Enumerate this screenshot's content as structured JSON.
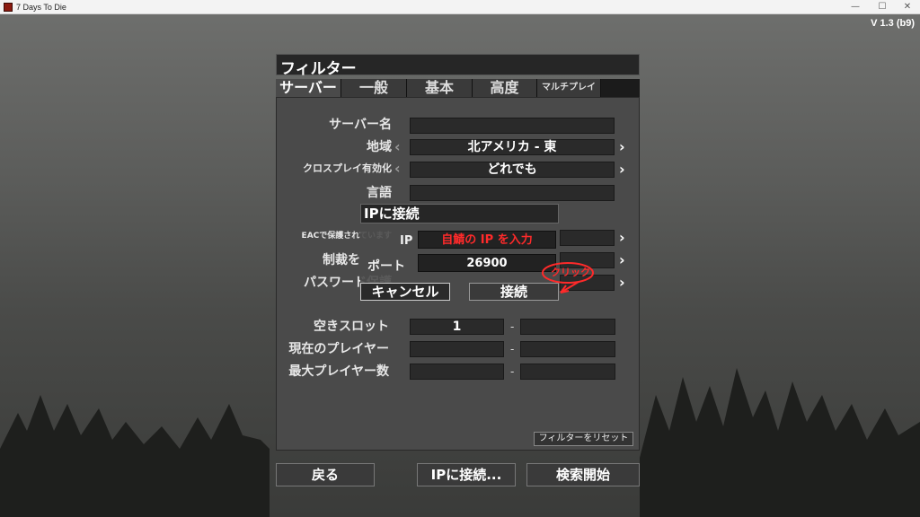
{
  "window": {
    "title": "7 Days To Die",
    "minimize": "—",
    "maximize": "☐",
    "close": "✕"
  },
  "version": "V 1.3 (b9)",
  "panel": {
    "title": "フィルター"
  },
  "tabs": [
    {
      "label": "サーバー",
      "active": true
    },
    {
      "label": "一般",
      "active": false
    },
    {
      "label": "基本",
      "active": false
    },
    {
      "label": "高度",
      "active": false
    },
    {
      "label": "マルチプレイ",
      "active": false
    }
  ],
  "filters": {
    "server_name": {
      "label": "サーバー名",
      "value": ""
    },
    "region": {
      "label": "地域",
      "value": "北アメリカ - 東"
    },
    "crossplay": {
      "label": "クロスプレイ有効化",
      "value": "どれでも"
    },
    "language": {
      "label": "言語",
      "value": ""
    },
    "eac": {
      "label": "EACで保護されています",
      "value": ""
    },
    "sanctions": {
      "label": "制裁を",
      "value": ""
    },
    "password": {
      "label": "パスワード保護",
      "value": ""
    },
    "free_slots": {
      "label": "空きスロット",
      "min": "1",
      "max": "",
      "sep": "-"
    },
    "current_players": {
      "label": "現在のプレイヤー",
      "min": "",
      "max": "",
      "sep": "-"
    },
    "max_players": {
      "label": "最大プレイヤー数",
      "min": "",
      "max": "",
      "sep": "-"
    }
  },
  "reset_button": "フィルターをリセット",
  "bottom_buttons": {
    "back": "戻る",
    "connect_ip": "IPに接続...",
    "search": "検索開始"
  },
  "dialog": {
    "title": "IPに接続",
    "ip_label": "IP",
    "ip_value": "自鯖の IP を入力",
    "port_label": "ポート",
    "port_value": "26900",
    "cancel": "キャンセル",
    "connect": "接続"
  },
  "annotation": {
    "text": "クリック",
    "color": "#ff2a2a"
  },
  "icons": {
    "left_arrow": "‹",
    "right_arrow": "›"
  }
}
